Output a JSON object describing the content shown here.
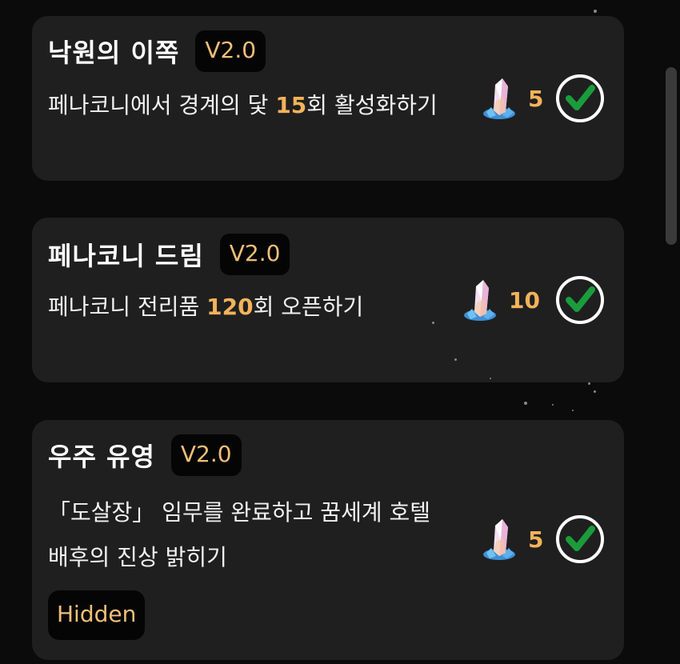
{
  "achievements": [
    {
      "title": "낙원의 이쪽",
      "version": "V2.0",
      "desc_before": "페나코니에서 경계의 닻 ",
      "desc_highlight": "15",
      "desc_after": "회 활성화하기",
      "reward_count": "5",
      "completed": true
    },
    {
      "title": "페나코니 드림",
      "version": "V2.0",
      "desc_before": "페나코니 전리품 ",
      "desc_highlight": "120",
      "desc_after": "회 오픈하기",
      "reward_count": "10",
      "completed": true
    },
    {
      "title": "우주 유영",
      "version": "V2.0",
      "desc_before": "「도살장」 임무를 완료하고 꿈세계 호텔 배후의 진상 밝히기",
      "desc_highlight": "",
      "desc_after": "",
      "reward_count": "5",
      "completed": true,
      "badge": "Hidden"
    }
  ],
  "icons": {
    "reward": "crystal-icon",
    "status": "check-circle-icon"
  },
  "colors": {
    "background": "#0b0b0b",
    "card": "#1f1f1f",
    "accent": "#f3b25a",
    "badge_text": "#f2bf78",
    "check": "#1a9c3c"
  }
}
